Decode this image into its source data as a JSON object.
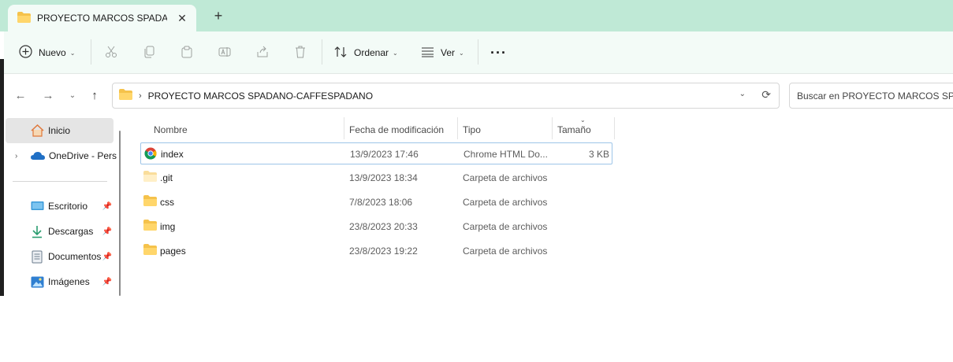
{
  "window": {
    "tab_title": "PROYECTO MARCOS SPADANO-CAFFESPADANO",
    "tab_title_visible": "PROYECTO MARCOS SPADAN",
    "new_tab_symbol": "+",
    "close_symbol": "✕"
  },
  "toolbar": {
    "new_label": "Nuevo",
    "sort_label": "Ordenar",
    "view_label": "Ver",
    "more_label": "···",
    "icons": [
      "cut-icon",
      "copy-icon",
      "paste-icon",
      "rename-icon",
      "share-icon",
      "delete-icon"
    ]
  },
  "address": {
    "path": "PROYECTO MARCOS SPADANO-CAFFESPADANO",
    "separator": "›",
    "search_placeholder": "Buscar en PROYECTO MARCOS SPADANO-CAFFESPADANO"
  },
  "sidebar": {
    "items": [
      {
        "label": "Inicio",
        "icon": "home-icon",
        "selected": true
      },
      {
        "label": "OneDrive - Personal",
        "icon": "onedrive-icon",
        "expandable": true
      },
      {
        "label": "Escritorio",
        "icon": "desktop-icon",
        "pinned": true
      },
      {
        "label": "Descargas",
        "icon": "download-icon",
        "pinned": true
      },
      {
        "label": "Documentos",
        "icon": "documents-icon",
        "pinned": true
      },
      {
        "label": "Imágenes",
        "icon": "pictures-icon",
        "pinned": true
      }
    ],
    "onedrive_visible": "OneDrive - Pers"
  },
  "file_list": {
    "columns": [
      "Nombre",
      "Fecha de modificación",
      "Tipo",
      "Tamaño"
    ],
    "rows": [
      {
        "name": "index",
        "modified": "13/9/2023 17:46",
        "type": "Chrome HTML Do...",
        "size": "3 KB",
        "icon": "chrome-icon",
        "selected": true
      },
      {
        "name": ".git",
        "modified": "13/9/2023 18:34",
        "type": "Carpeta de archivos",
        "size": "",
        "icon": "folder-hidden-icon"
      },
      {
        "name": "css",
        "modified": "7/8/2023 18:06",
        "type": "Carpeta de archivos",
        "size": "",
        "icon": "folder-icon"
      },
      {
        "name": "img",
        "modified": "23/8/2023 20:33",
        "type": "Carpeta de archivos",
        "size": "",
        "icon": "folder-icon"
      },
      {
        "name": "pages",
        "modified": "23/8/2023 19:22",
        "type": "Carpeta de archivos",
        "size": "",
        "icon": "folder-icon"
      }
    ]
  },
  "colors": {
    "titlebar": "#bfe9d6",
    "toolbar": "#f3fbf7",
    "folder": "#f5c24b",
    "selection_border": "#9ec5e8"
  }
}
